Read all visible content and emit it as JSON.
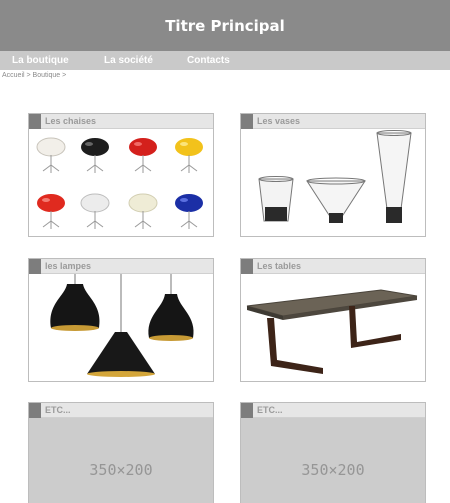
{
  "header": {
    "title": "Titre Principal"
  },
  "nav": {
    "items": [
      "La boutique",
      "La société",
      "Contacts"
    ]
  },
  "breadcrumb": "Accueil > Boutique >",
  "cards": [
    {
      "title": "Les chaises"
    },
    {
      "title": "Les vases"
    },
    {
      "title": "les lampes"
    },
    {
      "title": "Les tables"
    },
    {
      "title": "ETC...",
      "placeholder": "350×200"
    },
    {
      "title": "ETC...",
      "placeholder": "350×200"
    }
  ],
  "colors": {
    "header_bg": "#8a8a8a",
    "nav_bg": "#c9c9c9",
    "card_head_bg": "#e6e6e6",
    "card_marker": "#7d7d7d",
    "placeholder_bg": "#cccccc"
  },
  "icons": {
    "chairs": [
      "chair-white",
      "chair-black",
      "chair-red",
      "chair-yellow",
      "chair-red",
      "chair-white",
      "chair-cream",
      "chair-blue"
    ]
  }
}
